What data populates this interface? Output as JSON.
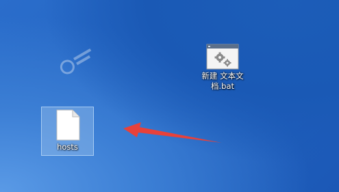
{
  "desktop": {
    "icons": [
      {
        "name": "bat-file",
        "label_line1": "新建 文本文",
        "label_line2": "档.bat",
        "icon": "batch-file-gear-icon"
      },
      {
        "name": "hosts-file",
        "label": "hosts",
        "icon": "blank-document-icon",
        "selected": true
      }
    ]
  },
  "annotation": {
    "icon": "red-arrow-icon",
    "color": "#e8413a"
  },
  "colors": {
    "wallpaper_blue": "#2465c2",
    "selection": "#9ec4ee"
  }
}
